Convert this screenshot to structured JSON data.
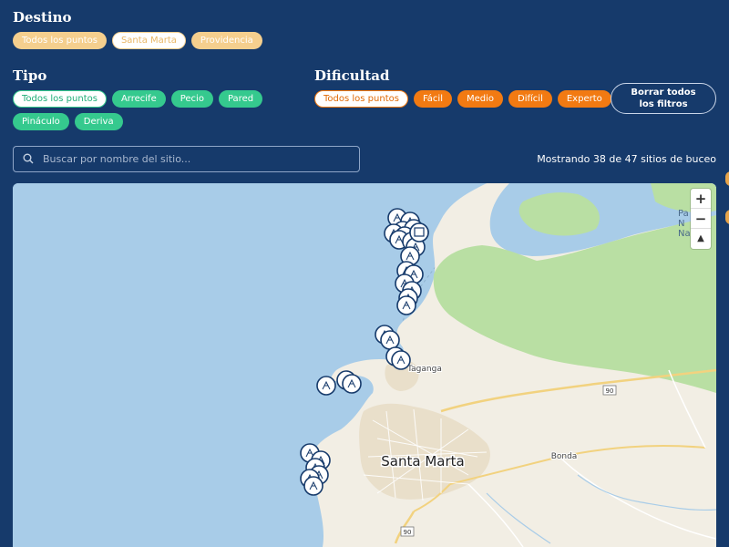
{
  "destino": {
    "title": "Destino",
    "chips": [
      {
        "label": "Todos los puntos",
        "active": false
      },
      {
        "label": "Santa Marta",
        "active": true
      },
      {
        "label": "Providencia",
        "active": false
      }
    ]
  },
  "tipo": {
    "title": "Tipo",
    "chips": [
      {
        "label": "Todos los puntos",
        "active": true
      },
      {
        "label": "Arrecife",
        "active": false
      },
      {
        "label": "Pecio",
        "active": false
      },
      {
        "label": "Pared",
        "active": false
      },
      {
        "label": "Pináculo",
        "active": false
      },
      {
        "label": "Deriva",
        "active": false
      }
    ]
  },
  "dificultad": {
    "title": "Dificultad",
    "chips": [
      {
        "label": "Todos los puntos",
        "active": true
      },
      {
        "label": "Fácil",
        "active": false
      },
      {
        "label": "Medio",
        "active": false
      },
      {
        "label": "Difícil",
        "active": false
      },
      {
        "label": "Experto",
        "active": false
      }
    ]
  },
  "clear_button": "Borrar todos los filtros",
  "search": {
    "placeholder": "Buscar por nombre del sitio..."
  },
  "count_text": "Mostrando 38 de 47 sitios de buceo",
  "map": {
    "labels": {
      "santa_marta": "Santa Marta",
      "taganga": "Taganga",
      "bonda": "Bonda",
      "park_1": "Pa",
      "park_2": "N",
      "park_3": "Na T",
      "road_90_a": "90",
      "road_90_b": "90"
    },
    "zoom_in": "+",
    "zoom_out": "−",
    "reset": "▲",
    "colors": {
      "sea": "#a9cde8",
      "land": "#f3efe6",
      "park": "#b6dea0",
      "urban": "#ece3d0",
      "road": "#f3d58a",
      "marker_border": "#163a6b"
    }
  }
}
